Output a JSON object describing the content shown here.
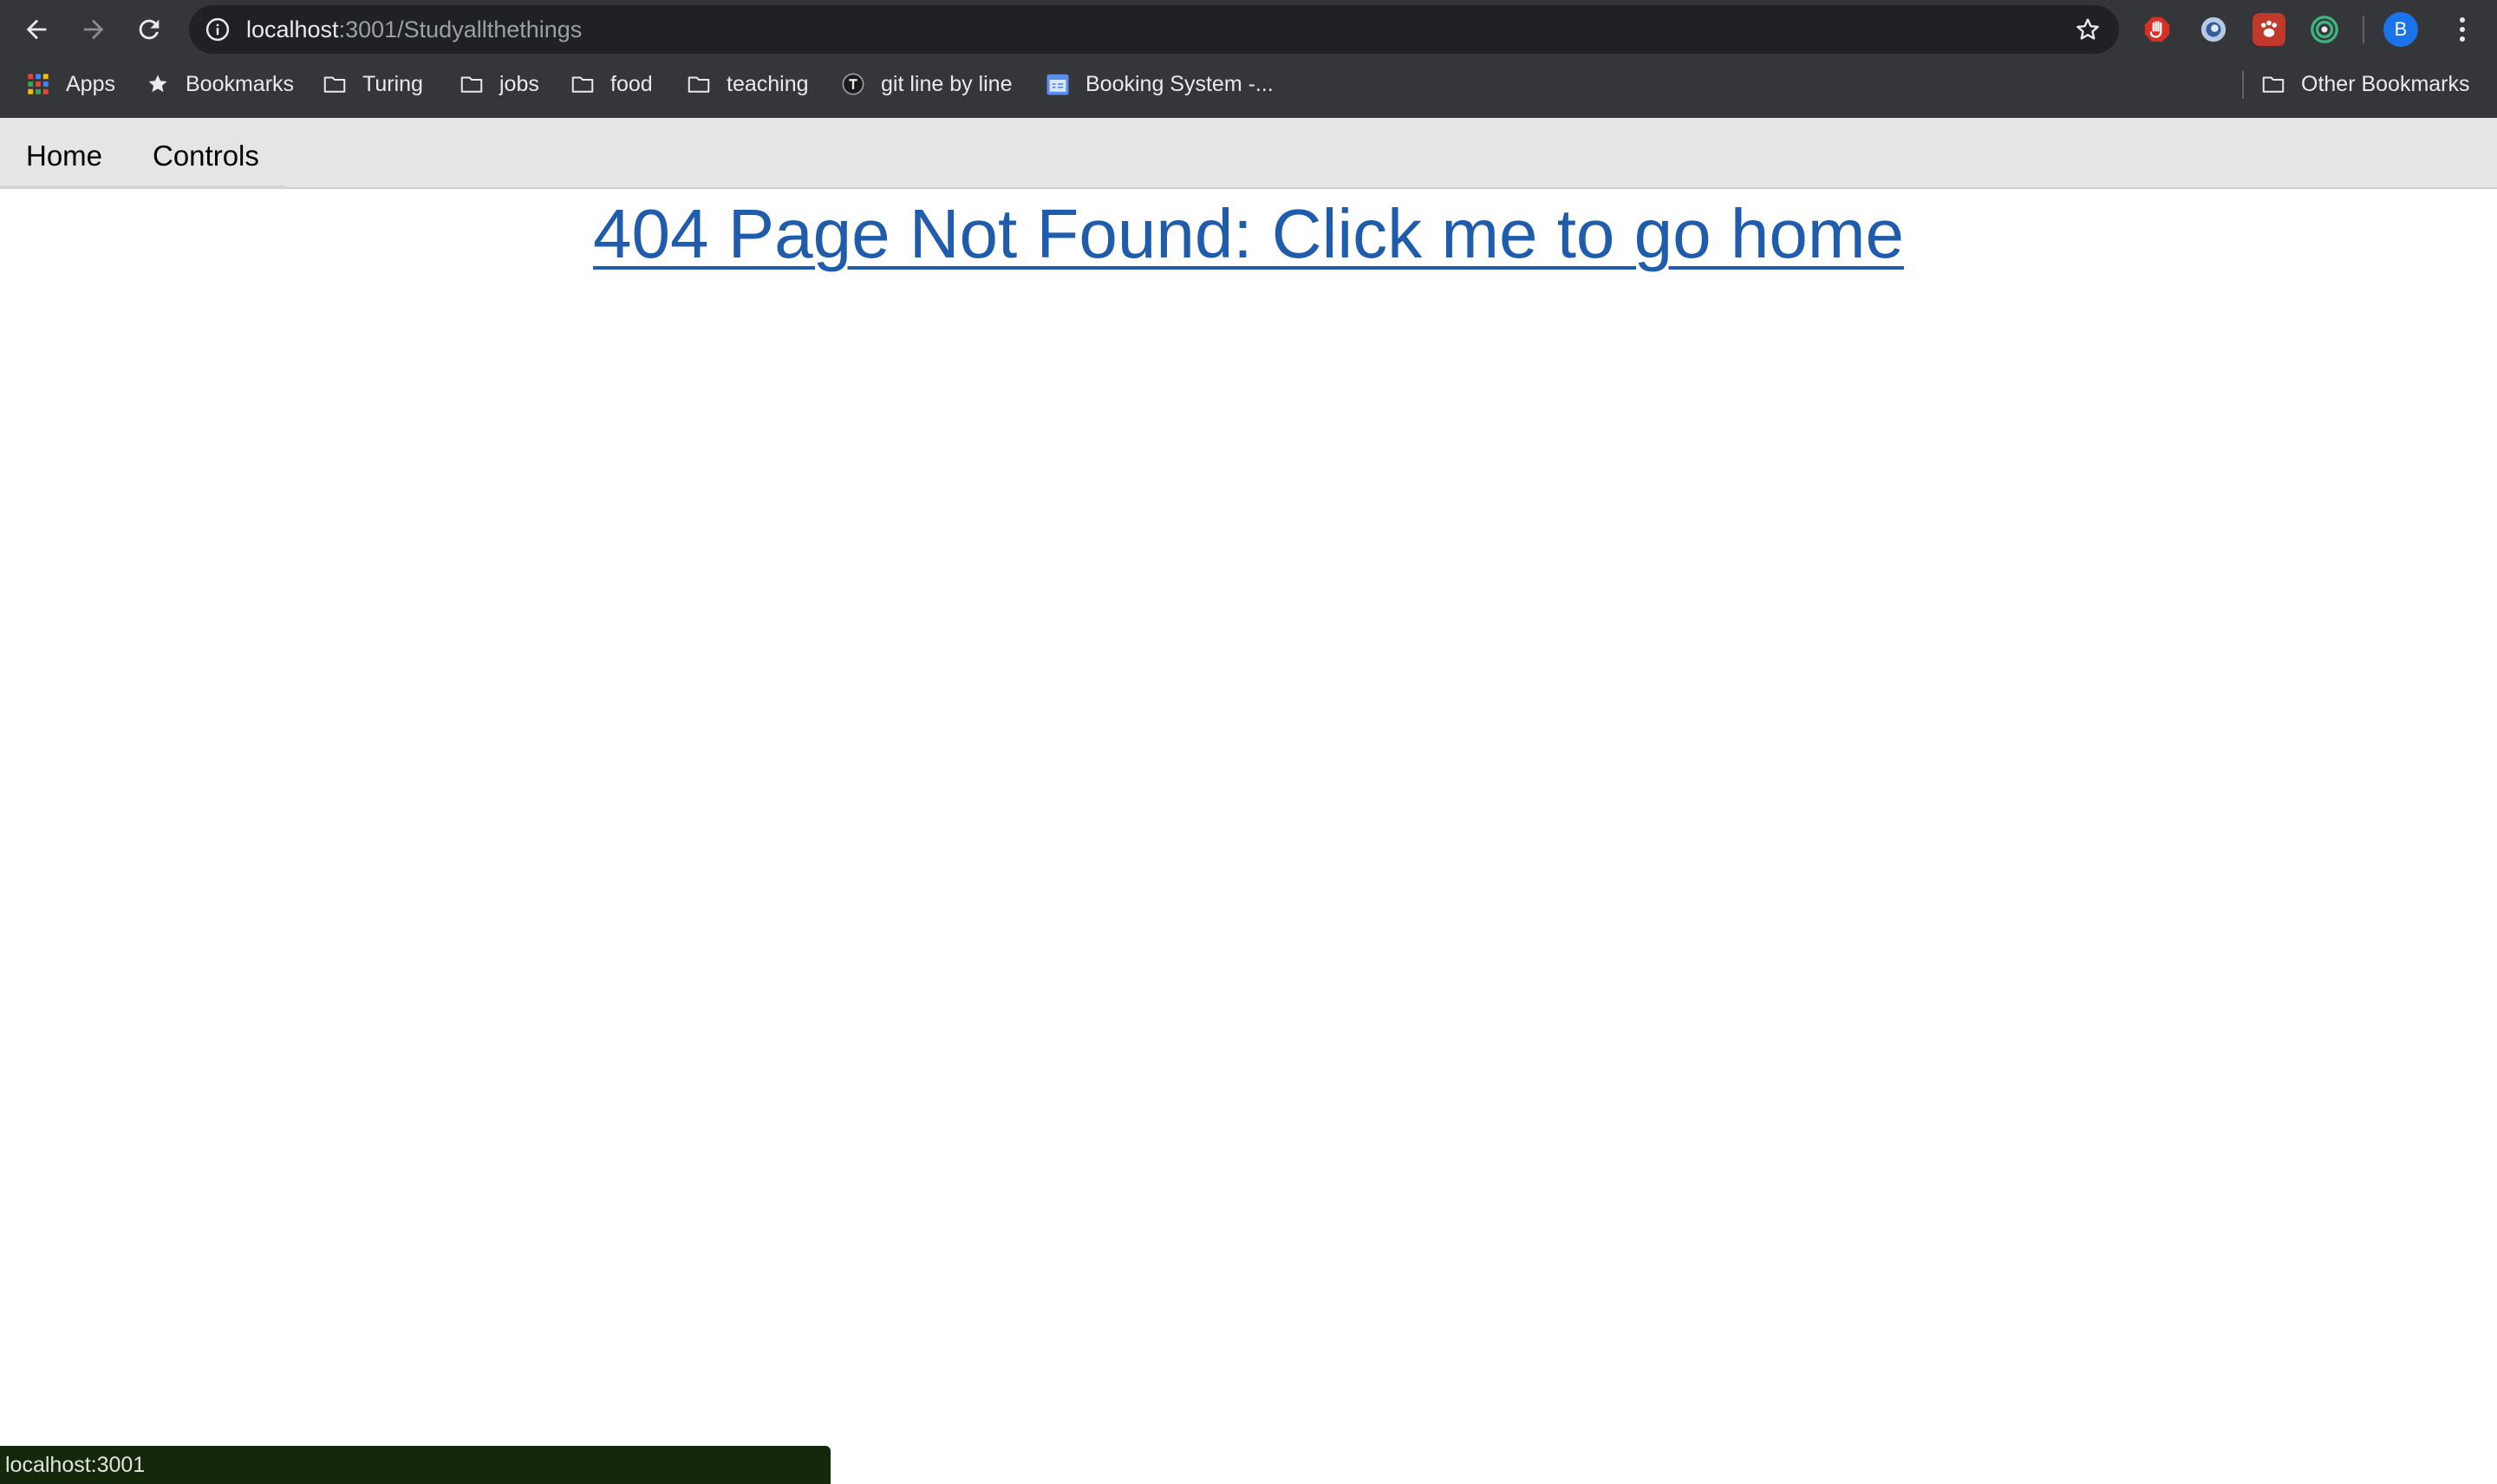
{
  "browser": {
    "url_host": "localhost",
    "url_path": ":3001/Studyallthethings",
    "profile_initial": "B",
    "bookmarks": [
      {
        "label": "Apps",
        "icon": "apps-grid-icon"
      },
      {
        "label": "Bookmarks",
        "icon": "star-icon"
      },
      {
        "label": "Turing",
        "icon": "folder-icon"
      },
      {
        "label": "jobs",
        "icon": "folder-icon"
      },
      {
        "label": "food",
        "icon": "folder-icon"
      },
      {
        "label": "teaching",
        "icon": "folder-icon"
      },
      {
        "label": "git line by line",
        "icon": "site-favicon"
      },
      {
        "label": "Booking System -...",
        "icon": "calendar-icon"
      }
    ],
    "other_bookmarks_label": "Other Bookmarks",
    "extensions": [
      "adblock-icon",
      "swirl-extension-icon",
      "paw-extension-icon",
      "target-extension-icon"
    ]
  },
  "app_nav": {
    "home_label": "Home",
    "controls_label": "Controls"
  },
  "main": {
    "not_found_text": "404 Page Not Found: Click me to go home"
  },
  "status_bar": {
    "text": "localhost:3001"
  },
  "colors": {
    "link": "#1f5cab",
    "chrome": "#35363a",
    "nav_bar": "#e5e5e5"
  }
}
